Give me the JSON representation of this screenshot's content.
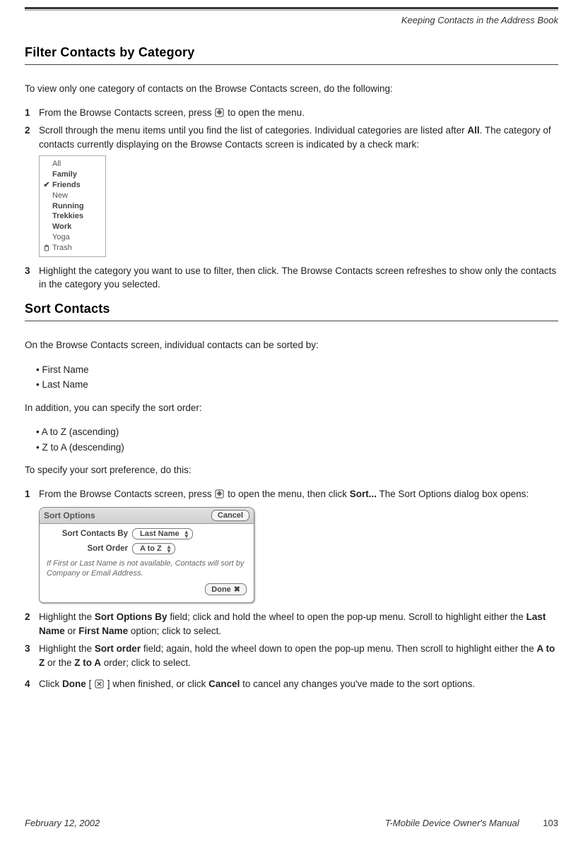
{
  "header": {
    "breadcrumb": "Keeping Contacts in the Address Book"
  },
  "section1": {
    "heading": "Filter Contacts by Category",
    "intro": "To view only one category of contacts on the Browse Contacts screen, do the following:",
    "step1a": "From the Browse Contacts screen, press ",
    "step1b": " to open the menu.",
    "step2a": "Scroll through the menu items until you find the list of categories. Individual categories are listed after ",
    "step2_bold": "All",
    "step2b": ". The category of contacts currently displaying on the Browse Contacts screen is indicated by a check mark:",
    "step3": "Highlight the category you want to use to filter, then click. The Browse Contacts screen refreshes to show only the contacts in the category you selected."
  },
  "category_menu": {
    "items": [
      {
        "label": "All",
        "bold": false,
        "checked": false,
        "icon": null
      },
      {
        "label": "Family",
        "bold": true,
        "checked": false,
        "icon": null
      },
      {
        "label": "Friends",
        "bold": true,
        "checked": true,
        "icon": null
      },
      {
        "label": "New",
        "bold": false,
        "checked": false,
        "icon": null
      },
      {
        "label": "Running",
        "bold": true,
        "checked": false,
        "icon": null
      },
      {
        "label": "Trekkies",
        "bold": true,
        "checked": false,
        "icon": null
      },
      {
        "label": "Work",
        "bold": true,
        "checked": false,
        "icon": null
      },
      {
        "label": "Yoga",
        "bold": false,
        "checked": false,
        "icon": null
      },
      {
        "label": "Trash",
        "bold": false,
        "checked": false,
        "icon": "trash"
      }
    ]
  },
  "section2": {
    "heading": "Sort Contacts",
    "intro": "On the Browse Contacts screen, individual contacts can be sorted by:",
    "bullets1": [
      "First Name",
      "Last Name"
    ],
    "intro2": "In addition, you can specify the sort order:",
    "bullets2": [
      "A to Z (ascending)",
      "Z to A (descending)"
    ],
    "intro3": "To specify your sort preference, do this:",
    "step1a": "From the Browse Contacts screen, press ",
    "step1b": " to open the menu, then click ",
    "step1_bold": "Sort...",
    "step1c": " The Sort Options dialog box opens:",
    "step2a": "Highlight the ",
    "step2_b1": "Sort Options By",
    "step2b": " field; click and hold the wheel to open the pop-up menu. Scroll to highlight either the ",
    "step2_b2": "Last Name",
    "step2c": " or ",
    "step2_b3": "First Name",
    "step2d": " option; click to select.",
    "step3a": "Highlight the ",
    "step3_b1": "Sort order",
    "step3b": " field; again, hold the wheel down to open the pop-up menu. Then scroll to highlight either the ",
    "step3_b2": "A to Z",
    "step3c": " or the ",
    "step3_b3": "Z to A",
    "step3d": " order; click to select.",
    "step4a": "Click ",
    "step4_b1": "Done",
    "step4b": " [ ",
    "step4c": " ] when finished, or click ",
    "step4_b2": "Cancel",
    "step4d": " to cancel any changes you've made to the sort options."
  },
  "dialog": {
    "title": "Sort Options",
    "cancel": "Cancel",
    "field1_label": "Sort Contacts By",
    "field1_value": "Last Name",
    "field2_label": "Sort Order",
    "field2_value": "A to Z",
    "hint": "If First or Last Name is not available, Contacts will sort by Company or Email Address.",
    "done": "Done"
  },
  "footer": {
    "date": "February 12, 2002",
    "manual": "T-Mobile Device Owner's Manual",
    "page": "103"
  }
}
